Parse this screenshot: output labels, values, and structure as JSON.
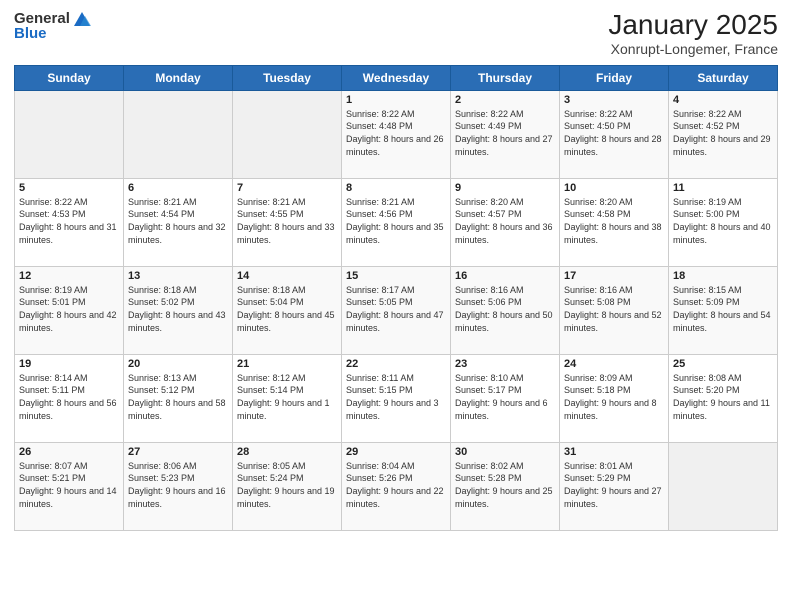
{
  "header": {
    "logo_general": "General",
    "logo_blue": "Blue",
    "title": "January 2025",
    "subtitle": "Xonrupt-Longemer, France"
  },
  "days_of_week": [
    "Sunday",
    "Monday",
    "Tuesday",
    "Wednesday",
    "Thursday",
    "Friday",
    "Saturday"
  ],
  "weeks": [
    [
      {
        "day": "",
        "info": ""
      },
      {
        "day": "",
        "info": ""
      },
      {
        "day": "",
        "info": ""
      },
      {
        "day": "1",
        "info": "Sunrise: 8:22 AM\nSunset: 4:48 PM\nDaylight: 8 hours and 26 minutes."
      },
      {
        "day": "2",
        "info": "Sunrise: 8:22 AM\nSunset: 4:49 PM\nDaylight: 8 hours and 27 minutes."
      },
      {
        "day": "3",
        "info": "Sunrise: 8:22 AM\nSunset: 4:50 PM\nDaylight: 8 hours and 28 minutes."
      },
      {
        "day": "4",
        "info": "Sunrise: 8:22 AM\nSunset: 4:52 PM\nDaylight: 8 hours and 29 minutes."
      }
    ],
    [
      {
        "day": "5",
        "info": "Sunrise: 8:22 AM\nSunset: 4:53 PM\nDaylight: 8 hours and 31 minutes."
      },
      {
        "day": "6",
        "info": "Sunrise: 8:21 AM\nSunset: 4:54 PM\nDaylight: 8 hours and 32 minutes."
      },
      {
        "day": "7",
        "info": "Sunrise: 8:21 AM\nSunset: 4:55 PM\nDaylight: 8 hours and 33 minutes."
      },
      {
        "day": "8",
        "info": "Sunrise: 8:21 AM\nSunset: 4:56 PM\nDaylight: 8 hours and 35 minutes."
      },
      {
        "day": "9",
        "info": "Sunrise: 8:20 AM\nSunset: 4:57 PM\nDaylight: 8 hours and 36 minutes."
      },
      {
        "day": "10",
        "info": "Sunrise: 8:20 AM\nSunset: 4:58 PM\nDaylight: 8 hours and 38 minutes."
      },
      {
        "day": "11",
        "info": "Sunrise: 8:19 AM\nSunset: 5:00 PM\nDaylight: 8 hours and 40 minutes."
      }
    ],
    [
      {
        "day": "12",
        "info": "Sunrise: 8:19 AM\nSunset: 5:01 PM\nDaylight: 8 hours and 42 minutes."
      },
      {
        "day": "13",
        "info": "Sunrise: 8:18 AM\nSunset: 5:02 PM\nDaylight: 8 hours and 43 minutes."
      },
      {
        "day": "14",
        "info": "Sunrise: 8:18 AM\nSunset: 5:04 PM\nDaylight: 8 hours and 45 minutes."
      },
      {
        "day": "15",
        "info": "Sunrise: 8:17 AM\nSunset: 5:05 PM\nDaylight: 8 hours and 47 minutes."
      },
      {
        "day": "16",
        "info": "Sunrise: 8:16 AM\nSunset: 5:06 PM\nDaylight: 8 hours and 50 minutes."
      },
      {
        "day": "17",
        "info": "Sunrise: 8:16 AM\nSunset: 5:08 PM\nDaylight: 8 hours and 52 minutes."
      },
      {
        "day": "18",
        "info": "Sunrise: 8:15 AM\nSunset: 5:09 PM\nDaylight: 8 hours and 54 minutes."
      }
    ],
    [
      {
        "day": "19",
        "info": "Sunrise: 8:14 AM\nSunset: 5:11 PM\nDaylight: 8 hours and 56 minutes."
      },
      {
        "day": "20",
        "info": "Sunrise: 8:13 AM\nSunset: 5:12 PM\nDaylight: 8 hours and 58 minutes."
      },
      {
        "day": "21",
        "info": "Sunrise: 8:12 AM\nSunset: 5:14 PM\nDaylight: 9 hours and 1 minute."
      },
      {
        "day": "22",
        "info": "Sunrise: 8:11 AM\nSunset: 5:15 PM\nDaylight: 9 hours and 3 minutes."
      },
      {
        "day": "23",
        "info": "Sunrise: 8:10 AM\nSunset: 5:17 PM\nDaylight: 9 hours and 6 minutes."
      },
      {
        "day": "24",
        "info": "Sunrise: 8:09 AM\nSunset: 5:18 PM\nDaylight: 9 hours and 8 minutes."
      },
      {
        "day": "25",
        "info": "Sunrise: 8:08 AM\nSunset: 5:20 PM\nDaylight: 9 hours and 11 minutes."
      }
    ],
    [
      {
        "day": "26",
        "info": "Sunrise: 8:07 AM\nSunset: 5:21 PM\nDaylight: 9 hours and 14 minutes."
      },
      {
        "day": "27",
        "info": "Sunrise: 8:06 AM\nSunset: 5:23 PM\nDaylight: 9 hours and 16 minutes."
      },
      {
        "day": "28",
        "info": "Sunrise: 8:05 AM\nSunset: 5:24 PM\nDaylight: 9 hours and 19 minutes."
      },
      {
        "day": "29",
        "info": "Sunrise: 8:04 AM\nSunset: 5:26 PM\nDaylight: 9 hours and 22 minutes."
      },
      {
        "day": "30",
        "info": "Sunrise: 8:02 AM\nSunset: 5:28 PM\nDaylight: 9 hours and 25 minutes."
      },
      {
        "day": "31",
        "info": "Sunrise: 8:01 AM\nSunset: 5:29 PM\nDaylight: 9 hours and 27 minutes."
      },
      {
        "day": "",
        "info": ""
      }
    ]
  ]
}
